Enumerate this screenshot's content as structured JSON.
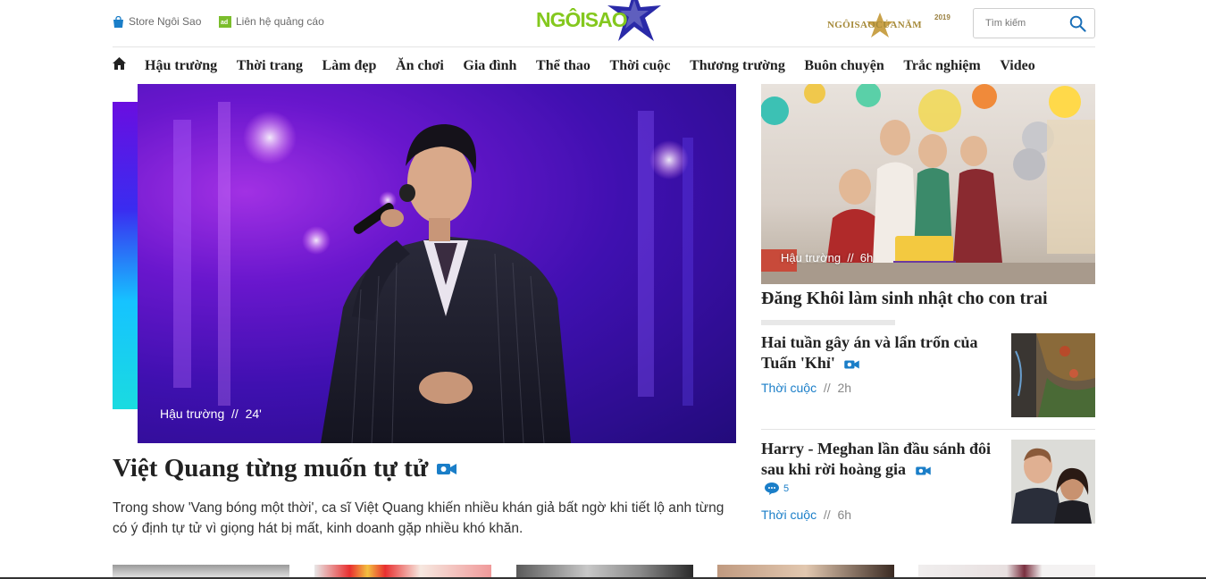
{
  "topbar": {
    "store_label": "Store Ngôi Sao",
    "ads_label": "Liên hệ quảng cáo",
    "logo_text": "NGÔISAO",
    "award_text": "NGÔISAOCỦANĂM",
    "award_year": "2019",
    "search_placeholder": "Tìm kiếm"
  },
  "nav": {
    "items": [
      "Hậu trường",
      "Thời trang",
      "Làm đẹp",
      "Ăn chơi",
      "Gia đình",
      "Thể thao",
      "Thời cuộc",
      "Thương trường",
      "Buôn chuyện",
      "Trắc nghiệm",
      "Video"
    ]
  },
  "hero": {
    "category": "Hậu trường",
    "time": "24'",
    "title": "Việt Quang từng muốn tự tử",
    "description": "Trong show 'Vang bóng một thời', ca sĩ Việt Quang khiến nhiều khán giả bất ngờ khi tiết lộ anh từng có ý định tự tử vì giọng hát bị mất, kinh doanh gặp nhiều khó khăn."
  },
  "side_featured": {
    "category": "Hậu trường",
    "time": "6h",
    "title": "Đăng Khôi làm sinh nhật cho con trai"
  },
  "side_items": [
    {
      "title": "Hai tuần gây án và lẩn trốn của Tuấn 'Khỉ'",
      "category": "Thời cuộc",
      "time": "2h"
    },
    {
      "title": "Harry - Meghan lần đầu sánh đôi sau khi rời hoàng gia",
      "category": "Thời cuộc",
      "time": "6h",
      "comments": "5"
    }
  ],
  "colors": {
    "logo_green": "#84c81e",
    "logo_blue": "#2a2aa8",
    "link_blue": "#1a7ec8",
    "award_gold": "#a68a3a"
  },
  "icons": {
    "store": "shopping-bag-icon",
    "ads": "ad-icon",
    "search": "search-icon",
    "home": "home-icon",
    "video": "video-camera-icon",
    "comment": "comment-bubble-icon"
  }
}
